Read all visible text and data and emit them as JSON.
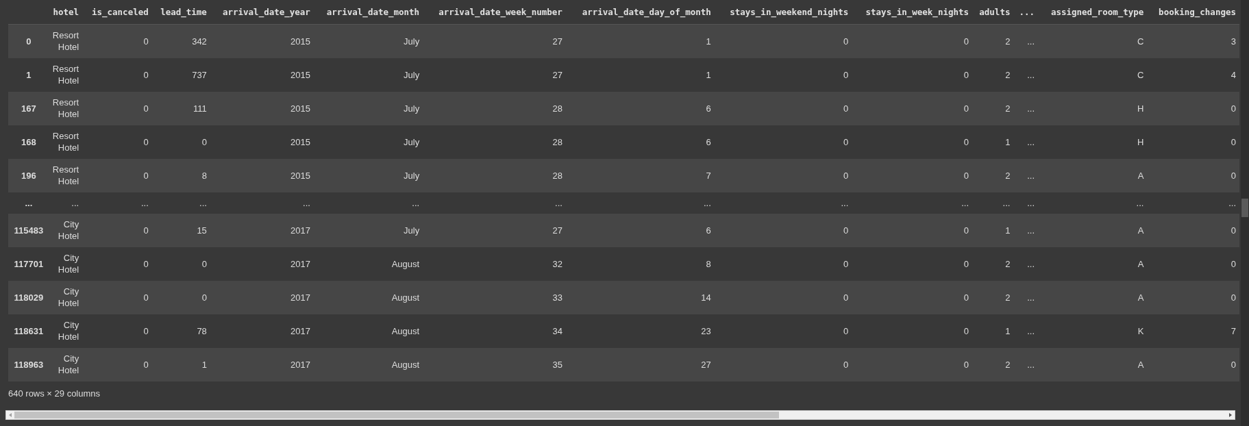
{
  "table": {
    "columns": [
      "hotel",
      "is_canceled",
      "lead_time",
      "arrival_date_year",
      "arrival_date_month",
      "arrival_date_week_number",
      "arrival_date_day_of_month",
      "stays_in_weekend_nights",
      "stays_in_week_nights",
      "adults",
      "...",
      "assigned_room_type",
      "booking_changes"
    ],
    "rows": [
      {
        "kind": "data",
        "index": "0",
        "cells": [
          "Resort Hotel",
          "0",
          "342",
          "2015",
          "July",
          "27",
          "1",
          "0",
          "0",
          "2",
          "...",
          "C",
          "3"
        ]
      },
      {
        "kind": "data",
        "index": "1",
        "cells": [
          "Resort Hotel",
          "0",
          "737",
          "2015",
          "July",
          "27",
          "1",
          "0",
          "0",
          "2",
          "...",
          "C",
          "4"
        ]
      },
      {
        "kind": "data",
        "index": "167",
        "cells": [
          "Resort Hotel",
          "0",
          "111",
          "2015",
          "July",
          "28",
          "6",
          "0",
          "0",
          "2",
          "...",
          "H",
          "0"
        ]
      },
      {
        "kind": "data",
        "index": "168",
        "cells": [
          "Resort Hotel",
          "0",
          "0",
          "2015",
          "July",
          "28",
          "6",
          "0",
          "0",
          "1",
          "...",
          "H",
          "0"
        ]
      },
      {
        "kind": "data",
        "index": "196",
        "cells": [
          "Resort Hotel",
          "0",
          "8",
          "2015",
          "July",
          "28",
          "7",
          "0",
          "0",
          "2",
          "...",
          "A",
          "0"
        ]
      },
      {
        "kind": "ellipsis",
        "index": "...",
        "cells": [
          "...",
          "...",
          "...",
          "...",
          "...",
          "...",
          "...",
          "...",
          "...",
          "...",
          "...",
          "...",
          "..."
        ]
      },
      {
        "kind": "data",
        "index": "115483",
        "cells": [
          "City Hotel",
          "0",
          "15",
          "2017",
          "July",
          "27",
          "6",
          "0",
          "0",
          "1",
          "...",
          "A",
          "0"
        ]
      },
      {
        "kind": "data",
        "index": "117701",
        "cells": [
          "City Hotel",
          "0",
          "0",
          "2017",
          "August",
          "32",
          "8",
          "0",
          "0",
          "2",
          "...",
          "A",
          "0"
        ]
      },
      {
        "kind": "data",
        "index": "118029",
        "cells": [
          "City Hotel",
          "0",
          "0",
          "2017",
          "August",
          "33",
          "14",
          "0",
          "0",
          "2",
          "...",
          "A",
          "0"
        ]
      },
      {
        "kind": "data",
        "index": "118631",
        "cells": [
          "City Hotel",
          "0",
          "78",
          "2017",
          "August",
          "34",
          "23",
          "0",
          "0",
          "1",
          "...",
          "K",
          "7"
        ]
      },
      {
        "kind": "data",
        "index": "118963",
        "cells": [
          "City Hotel",
          "0",
          "1",
          "2017",
          "August",
          "35",
          "27",
          "0",
          "0",
          "2",
          "...",
          "A",
          "0"
        ]
      }
    ]
  },
  "caption": "640 rows × 29 columns"
}
